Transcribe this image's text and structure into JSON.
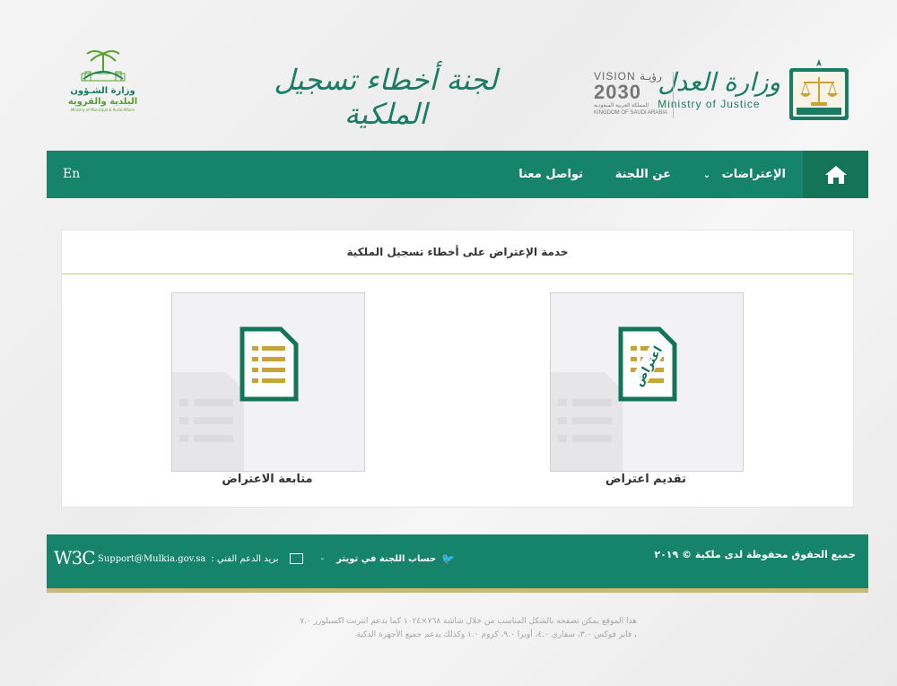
{
  "header": {
    "moj_name_ar": "وزارة العدل",
    "moj_name_en": "Ministry of Justice",
    "vision_top": "VISION رؤيـة",
    "vision_year": "2030",
    "vision_sub_ar": "المملكة العربية السعودية",
    "vision_sub_en": "KINGDOM OF SAUDI ARABIA",
    "site_title": "لجنة أخطاء تسجيل الملكية",
    "momra_line1": "وزارة الشـؤون",
    "momra_line2": "البلدية والقروية",
    "momra_en": "Ministry of Municipal & Rural Affairs"
  },
  "nav": {
    "objections": "الإعتراضات",
    "about": "عن اللجنة",
    "contact": "تواصل معنا",
    "lang": "En"
  },
  "main": {
    "title": "خدمة الإعتراض على أخطاء تسجيل الملكية",
    "submit_label": "تقديم اعتراض",
    "submit_icon_text": "اعتراض",
    "follow_label": "متابعة الاعتراض"
  },
  "footer": {
    "copyright": "جميع الحقوق محفوظة لدى ملكية © ٢٠١٩",
    "twitter": "حساب اللجنة في تويتر",
    "separator": "-",
    "support_label": "بريد الدعم الفني :",
    "support_email": "Support@Mulkia.gov.sa",
    "w3c": "W3C"
  },
  "note": {
    "line1": "هذا الموقع يمكن تصفحه بالشكل المناسب من خلال شاشة ٧٦٨×١٠٢٤ كما يدعم انترنت اكسبلورر ٧.٠",
    "line2": "، فاير فوكس ٣.٠، سفاري ٤.٠، أوبرا ٩.٠، كروم ١.٠ وكذلك يدعم جميع الأجهزة الذكية"
  },
  "colors": {
    "primary_green": "#16846a",
    "dark_green": "#137458",
    "gold": "#c9b77c"
  }
}
